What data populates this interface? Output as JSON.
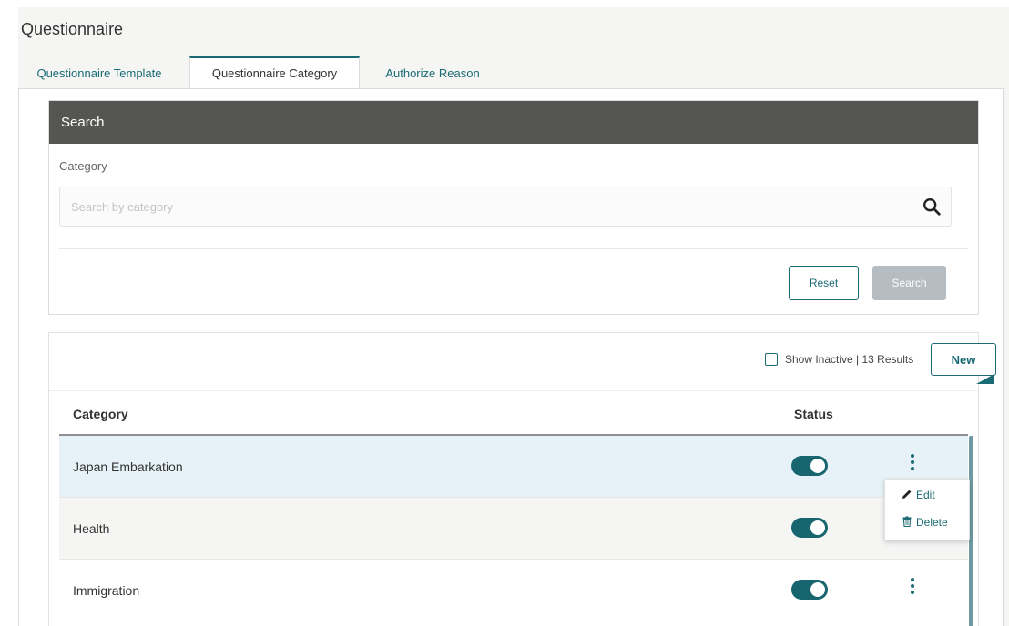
{
  "page": {
    "title": "Questionnaire"
  },
  "tabs": [
    {
      "label": "Questionnaire Template"
    },
    {
      "label": "Questionnaire Category"
    },
    {
      "label": "Authorize Reason"
    }
  ],
  "search": {
    "header": "Search",
    "category_label": "Category",
    "placeholder": "Search by category",
    "value": "",
    "reset_label": "Reset",
    "search_label": "Search"
  },
  "results": {
    "show_inactive_label": "Show Inactive | 13 Results",
    "new_label": "New",
    "columns": {
      "category": "Category",
      "status": "Status"
    },
    "rows": [
      {
        "category": "Japan Embarkation",
        "status_active": true
      },
      {
        "category": "Health",
        "status_active": true
      },
      {
        "category": "Immigration",
        "status_active": true
      }
    ]
  },
  "context_menu": {
    "edit_label": "Edit",
    "delete_label": "Delete"
  },
  "colors": {
    "accent": "#1a6b73",
    "header_bg": "#555553",
    "selected_row": "#e6f2f7",
    "disabled_button": "#b5bcc2"
  },
  "icons": [
    "search-icon",
    "kebab-menu-icon",
    "pencil-icon",
    "trash-icon",
    "checkbox-icon",
    "toggle-switch"
  ]
}
